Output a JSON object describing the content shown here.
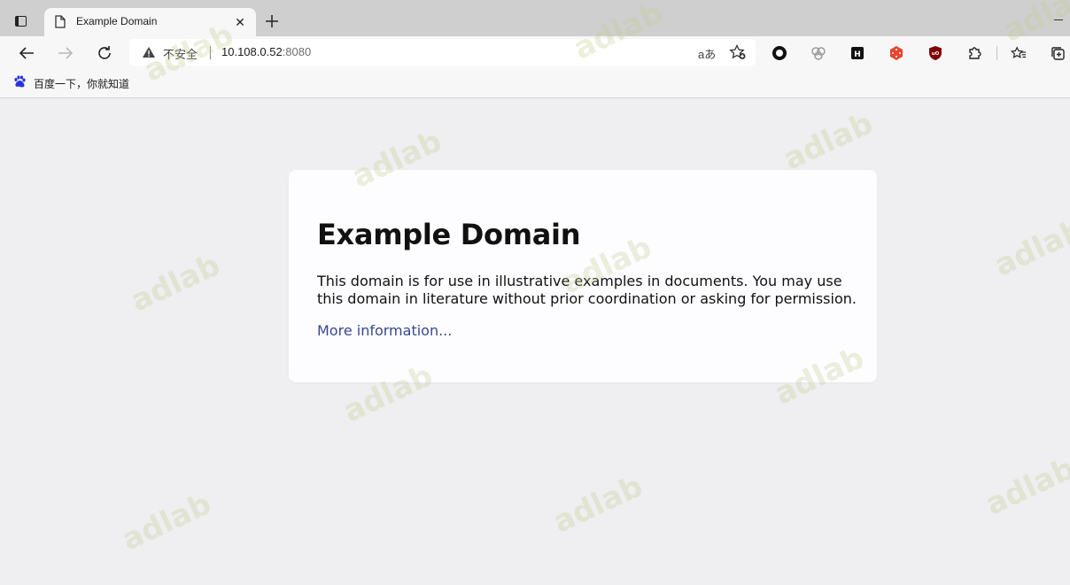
{
  "tabs": [
    {
      "title": "Example Domain",
      "favicon": "document-icon",
      "active": true
    }
  ],
  "toolbar": {
    "security_label": "不安全",
    "url_host": "10.108.0.52",
    "url_port": ":8080",
    "read_aloud_glyph": "aあ"
  },
  "bookmarks": [
    {
      "label": "百度一下，你就知道",
      "icon": "baidu-paw-icon"
    }
  ],
  "page": {
    "heading": "Example Domain",
    "paragraph": "This domain is for use in illustrative examples in documents. You may use this domain in literature without prior coordination or asking for permission.",
    "link_text": "More information..."
  },
  "extensions": [
    "record-icon",
    "copilot-icon",
    "hackernews-icon",
    "dice-icon",
    "ublock-icon"
  ],
  "watermark_text": "adlab",
  "colors": {
    "tabstrip": "#cfcfcf",
    "toolbar": "#f7f7f7",
    "page_bg": "#efeff1",
    "card_bg": "#fdfdff",
    "link": "#38488f"
  }
}
